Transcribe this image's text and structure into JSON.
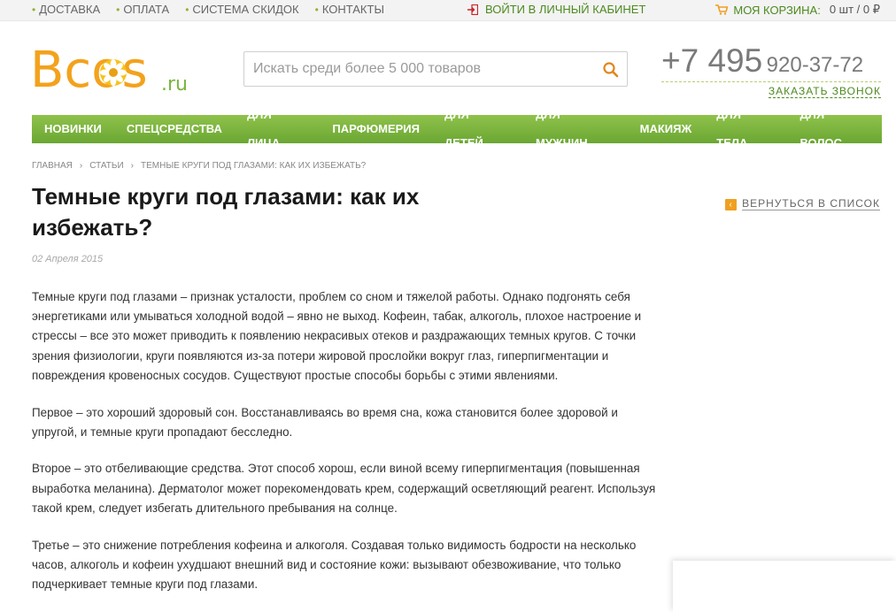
{
  "topbar": {
    "links": [
      "ДОСТАВКА",
      "ОПЛАТА",
      "СИСТЕМА СКИДОК",
      "КОНТАКТЫ"
    ],
    "login": "ВОЙТИ В ЛИЧНЫЙ КАБИНЕТ",
    "cart_label": "МОЯ КОРЗИНА:",
    "cart_value": "0 шт / 0 ₽"
  },
  "logo": {
    "main": "Bcos",
    "suffix": ".ru"
  },
  "search": {
    "placeholder": "Искать среди более 5 000 товаров"
  },
  "phone": {
    "code": "+7 495",
    "number": "920-37-72",
    "callback": "ЗАКАЗАТЬ ЗВОНОК"
  },
  "nav": [
    "НОВИНКИ",
    "СПЕЦСРЕДСТВА",
    "ДЛЯ ЛИЦА",
    "ПАРФЮМЕРИЯ",
    "ДЛЯ ДЕТЕЙ",
    "ДЛЯ МУЖЧИН",
    "МАКИЯЖ",
    "ДЛЯ ТЕЛА",
    "ДЛЯ ВОЛОС"
  ],
  "breadcrumb": [
    "ГЛАВНАЯ",
    "СТАТЬИ",
    "ТЕМНЫЕ КРУГИ ПОД ГЛАЗАМИ: КАК ИХ ИЗБЕЖАТЬ?"
  ],
  "article": {
    "title": "Темные круги под глазами: как их избежать?",
    "date": "02 Апреля 2015",
    "back": "ВЕРНУТЬСЯ В СПИСОК",
    "paragraphs": [
      "Темные круги под глазами – признак усталости, проблем со сном и тяжелой работы. Однако подгонять себя энергетиками или умываться холодной водой – явно не выход. Кофеин, табак, алкоголь, плохое настроение и стрессы – все это может приводить к появлению некрасивых отеков и раздражающих темных кругов. С точки зрения физиологии, круги появляются из-за потери жировой прослойки вокруг глаз, гиперпигментации и повреждения кровеносных сосудов. Существуют простые способы борьбы с этими явлениями.",
      "Первое – это хороший здоровый сон. Восстанавливаясь во время сна, кожа становится более здоровой и упругой, и темные круги пропадают бесследно.",
      "Второе – это отбеливающие средства. Этот способ хорош, если виной всему гиперпигментация (повышенная выработка меланина). Дерматолог может порекомендовать крем, содержащий осветляющий реагент. Используя такой крем, следует избегать длительного пребывания на солнце.",
      "Третье – это снижение потребления кофеина и алкоголя. Создавая только видимость бодрости на несколько часов, алкоголь и кофеин ухудшают внешний вид и состояние кожи: вызывают обезвоживание, что только подчеркивает темные круги под глазами."
    ]
  },
  "colors": {
    "green": "#4c8a1f",
    "nav": "#7ab53f",
    "orange": "#f0a020"
  }
}
